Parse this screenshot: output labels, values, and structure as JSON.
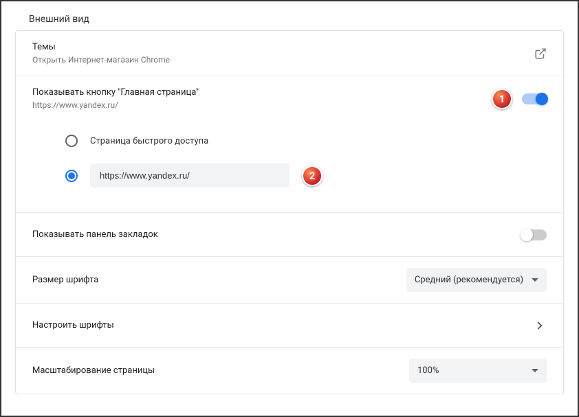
{
  "section_title": "Внешний вид",
  "themes": {
    "title": "Темы",
    "subtitle": "Открыть Интернет-магазин Chrome"
  },
  "home_button": {
    "title": "Показывать кнопку \"Главная страница\"",
    "subtitle": "https://www.yandex.ru/",
    "toggle_on": true,
    "radio": {
      "quick_access_label": "Страница быстрого доступа",
      "url_value": "https://www.yandex.ru/",
      "selected": "url"
    }
  },
  "bookmarks_bar": {
    "title": "Показывать панель закладок",
    "toggle_on": false
  },
  "font_size": {
    "title": "Размер шрифта",
    "value": "Средний (рекомендуется)"
  },
  "customize_fonts": {
    "title": "Настроить шрифты"
  },
  "zoom": {
    "title": "Масштабирование страницы",
    "value": "100%"
  },
  "callouts": {
    "c1": "1",
    "c2": "2"
  }
}
